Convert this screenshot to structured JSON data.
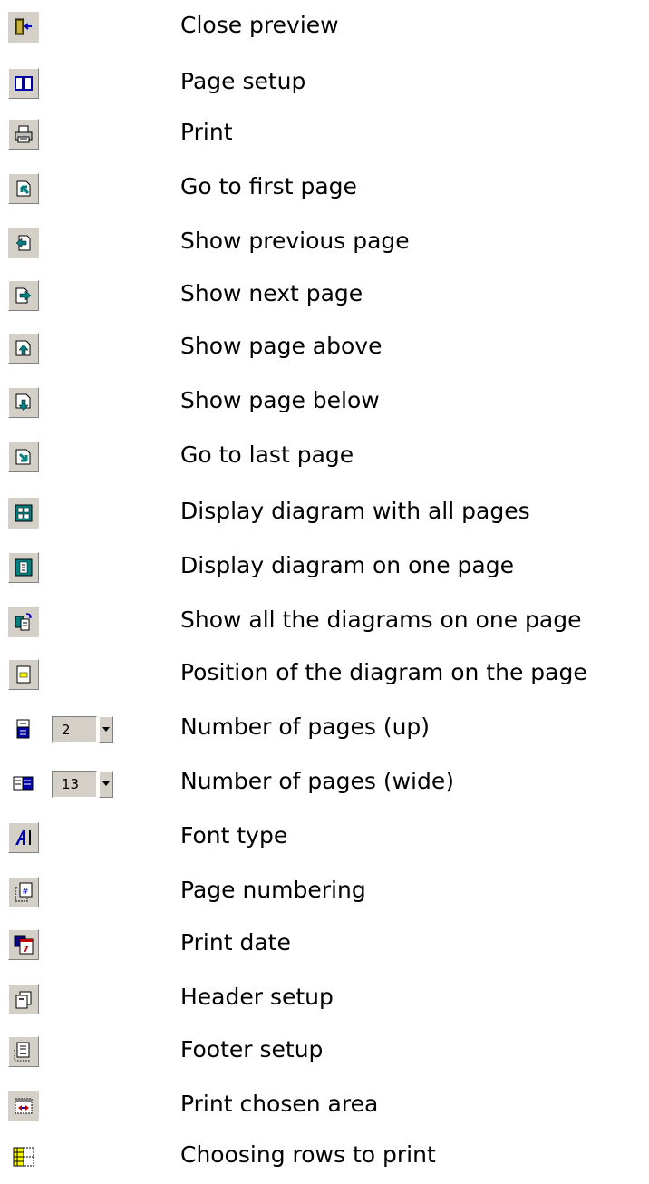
{
  "items": [
    {
      "label": "Close preview",
      "icon": "close-preview-icon"
    },
    {
      "label": "Page setup",
      "icon": "page-setup-icon"
    },
    {
      "label": "Print",
      "icon": "printer-icon"
    },
    {
      "label": "Go to first page",
      "icon": "first-page-icon"
    },
    {
      "label": "Show previous page",
      "icon": "previous-page-icon"
    },
    {
      "label": "Show next page",
      "icon": "next-page-icon"
    },
    {
      "label": "Show page above",
      "icon": "page-above-icon"
    },
    {
      "label": "Show page below",
      "icon": "page-below-icon"
    },
    {
      "label": "Go to last page",
      "icon": "last-page-icon"
    },
    {
      "label": "Display diagram with all pages",
      "icon": "all-pages-icon"
    },
    {
      "label": "Display diagram on one page",
      "icon": "one-page-icon"
    },
    {
      "label": "Show all the diagrams on one page",
      "icon": "all-diagrams-icon"
    },
    {
      "label": "Position of the diagram on the page",
      "icon": "position-icon"
    },
    {
      "label": "Number of pages (up)",
      "icon": "pages-up-icon",
      "value": "2"
    },
    {
      "label": "Number of pages (wide)",
      "icon": "pages-wide-icon",
      "value": "13"
    },
    {
      "label": "Font type",
      "icon": "font-type-icon"
    },
    {
      "label": "Page numbering",
      "icon": "page-numbering-icon"
    },
    {
      "label": "Print date",
      "icon": "print-date-icon"
    },
    {
      "label": "Header setup",
      "icon": "header-setup-icon"
    },
    {
      "label": "Footer setup",
      "icon": "footer-setup-icon"
    },
    {
      "label": "Print chosen area",
      "icon": "print-area-icon"
    },
    {
      "label": "Choosing rows to print",
      "icon": "choose-rows-icon"
    }
  ]
}
